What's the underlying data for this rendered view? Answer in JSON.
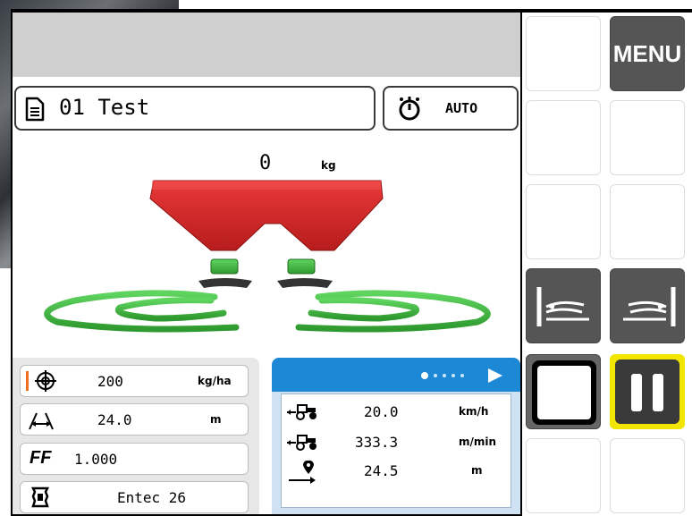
{
  "header": {
    "job_name": "01 Test",
    "mode_label": "AUTO"
  },
  "spreader": {
    "weight": "0",
    "weight_unit": "kg"
  },
  "settings": {
    "rate": {
      "value": "200",
      "unit": "kg/ha",
      "icon": "target-icon"
    },
    "width": {
      "value": "24.0",
      "unit": "m",
      "icon": "working-width-icon"
    },
    "flow_factor": {
      "label": "FF",
      "value": "1.000"
    },
    "fertilizer": {
      "value": "Entec 26",
      "icon": "fertilizer-bag-icon"
    }
  },
  "stats": {
    "page_indicator": {
      "pages": 5,
      "current": 1
    },
    "speed": {
      "value": "20.0",
      "unit": "km/h",
      "icon": "tractor-speed-icon"
    },
    "flow": {
      "value": "333.3",
      "unit": "m/min",
      "icon": "tractor-flow-icon"
    },
    "distance": {
      "value": "24.5",
      "unit": "m",
      "icon": "distance-icon"
    }
  },
  "sidebar": {
    "menu_label": "MENU",
    "buttons": [
      "menu-button",
      "left-boundary-spread-button",
      "right-boundary-spread-button",
      "stop-button",
      "pause-button"
    ]
  },
  "colors": {
    "hopper_red": "#d42a2a",
    "spread_green": "#4cb54c",
    "stats_header_blue": "#1d88d6",
    "pause_border": "#f2e600",
    "rate_marker": "#f07020"
  }
}
